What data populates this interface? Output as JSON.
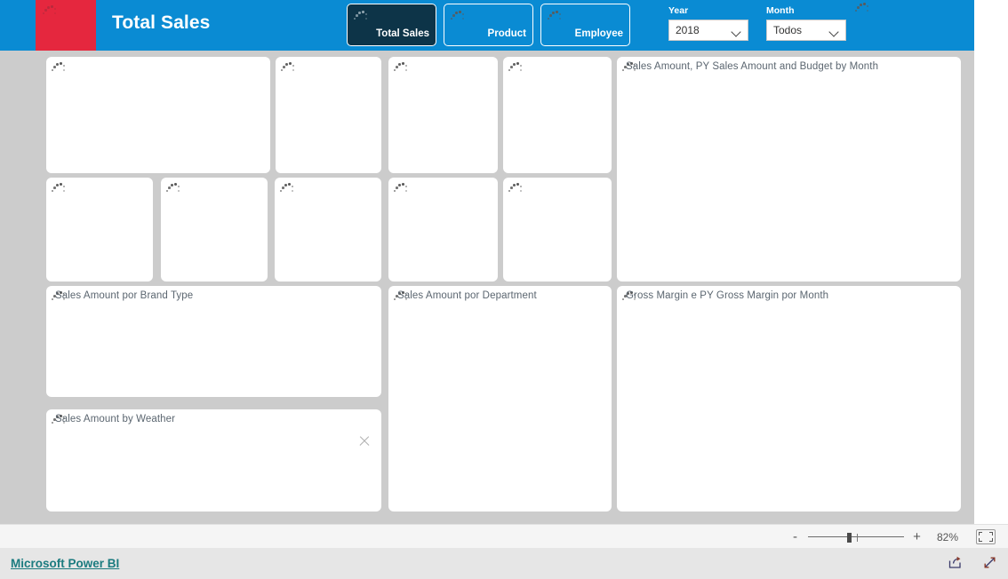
{
  "header": {
    "title": "Total Sales",
    "accent_color": "#e5273e",
    "band_color": "#0a8bd3",
    "nav_buttons": [
      {
        "label": "Total Sales",
        "active": true
      },
      {
        "label": "Product",
        "active": false
      },
      {
        "label": "Employee",
        "active": false
      }
    ],
    "slicers": [
      {
        "label": "Year",
        "value": "2018",
        "icon": "chevron-down-icon"
      },
      {
        "label": "Month",
        "value": "Todos",
        "icon": "chevron-down-icon"
      }
    ]
  },
  "canvas": {
    "background_color": "#cccccc",
    "kpi_row_1": [
      {
        "title": "",
        "state": "loading"
      },
      {
        "title": "",
        "state": "loading"
      },
      {
        "title": "",
        "state": "loading"
      },
      {
        "title": "",
        "state": "loading"
      }
    ],
    "kpi_row_2": [
      {
        "title": "",
        "state": "loading"
      },
      {
        "title": "",
        "state": "loading"
      },
      {
        "title": "",
        "state": "loading"
      },
      {
        "title": "",
        "state": "loading"
      },
      {
        "title": "",
        "state": "loading"
      }
    ],
    "charts": [
      {
        "title": "Sales Amount, PY Sales Amount and Budget by Month",
        "state": "loading"
      },
      {
        "title": "Sales Amount por Brand Type",
        "state": "loading"
      },
      {
        "title": "Sales Amount por Department",
        "state": "loading"
      },
      {
        "title": "Gross Margin e PY Gross Margin por Month",
        "state": "loading"
      },
      {
        "title": "Sales Amount by Weather",
        "state": "loading",
        "close_icon": "close-icon"
      }
    ]
  },
  "statusbar": {
    "zoom_out_label": "-",
    "zoom_in_label": "+",
    "zoom_value": "82%",
    "fit_icon": "fit-to-page-icon"
  },
  "footer": {
    "brand_label": "Microsoft Power BI",
    "brand_color": "#1b7b7f",
    "icons": [
      {
        "name": "share-icon"
      },
      {
        "name": "fullscreen-icon"
      }
    ]
  }
}
